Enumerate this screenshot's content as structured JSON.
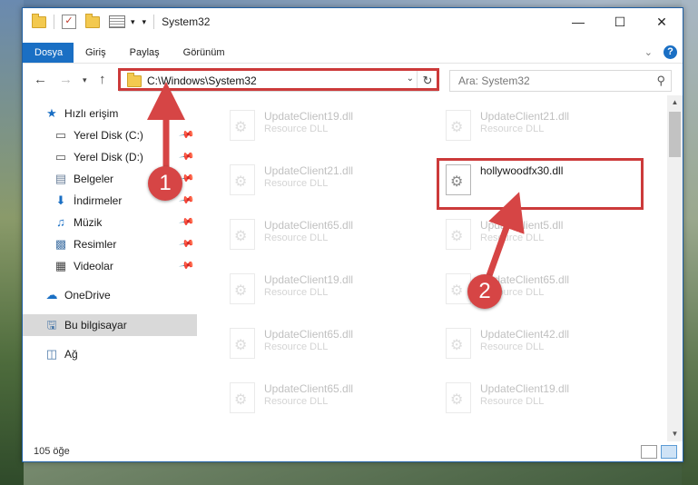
{
  "window": {
    "title": "System32"
  },
  "ribbon": {
    "tabs": [
      "Dosya",
      "Giriş",
      "Paylaş",
      "Görünüm"
    ]
  },
  "address": {
    "path": "C:\\Windows\\System32"
  },
  "search": {
    "placeholder": "Ara: System32"
  },
  "sidebar": {
    "items": [
      {
        "label": "Hızlı erişim",
        "icon": "star-icon"
      },
      {
        "label": "Yerel Disk (C:)",
        "icon": "drive-icon",
        "pinned": true
      },
      {
        "label": "Yerel Disk (D:)",
        "icon": "drive-icon",
        "pinned": true
      },
      {
        "label": "Belgeler",
        "icon": "documents-icon",
        "pinned": true
      },
      {
        "label": "İndirmeler",
        "icon": "download-icon",
        "pinned": true
      },
      {
        "label": "Müzik",
        "icon": "music-icon",
        "pinned": true
      },
      {
        "label": "Resimler",
        "icon": "pictures-icon",
        "pinned": true
      },
      {
        "label": "Videolar",
        "icon": "videos-icon",
        "pinned": true
      },
      {
        "label": "OneDrive",
        "icon": "cloud-icon"
      },
      {
        "label": "Bu bilgisayar",
        "icon": "computer-icon",
        "selected": true
      },
      {
        "label": "Ağ",
        "icon": "network-icon"
      }
    ]
  },
  "files": [
    {
      "name": "UpdateClient19.dll",
      "type": "Resource DLL",
      "faded": true
    },
    {
      "name": "UpdateClient21.dll",
      "type": "Resource DLL",
      "faded": true
    },
    {
      "name": "UpdateClient21.dll",
      "type": "Resource DLL",
      "faded": true
    },
    {
      "name": "hollywoodfx30.dll",
      "type": "",
      "faded": false
    },
    {
      "name": "UpdateClient65.dll",
      "type": "Resource DLL",
      "faded": true
    },
    {
      "name": "UpdateClient5.dll",
      "type": "Resource DLL",
      "faded": true
    },
    {
      "name": "UpdateClient19.dll",
      "type": "Resource DLL",
      "faded": true
    },
    {
      "name": "UpdateClient65.dll",
      "type": "Resource DLL",
      "faded": true
    },
    {
      "name": "UpdateClient65.dll",
      "type": "Resource DLL",
      "faded": true
    },
    {
      "name": "UpdateClient42.dll",
      "type": "Resource DLL",
      "faded": true
    },
    {
      "name": "UpdateClient65.dll",
      "type": "Resource DLL",
      "faded": true
    },
    {
      "name": "UpdateClient19.dll",
      "type": "Resource DLL",
      "faded": true
    }
  ],
  "status": {
    "item_count": "105 öğe"
  },
  "annotations": {
    "step1": "1",
    "step2": "2",
    "highlight_color": "#cc3a3a"
  }
}
